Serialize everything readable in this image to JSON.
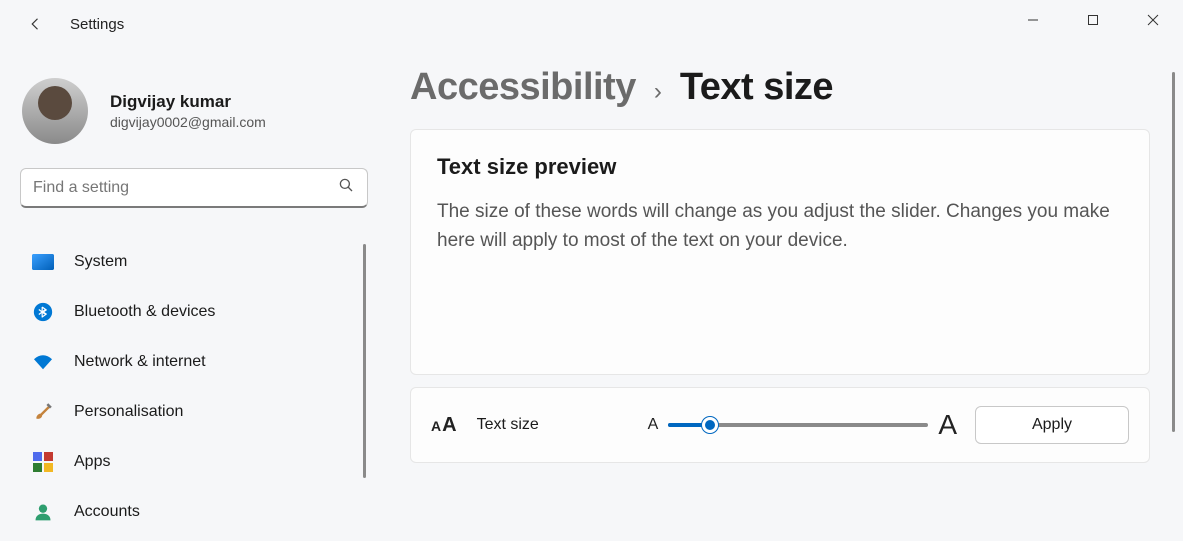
{
  "window": {
    "title": "Settings"
  },
  "user": {
    "name": "Digvijay kumar",
    "email": "digvijay0002@gmail.com"
  },
  "search": {
    "placeholder": "Find a setting"
  },
  "sidebar": {
    "items": [
      {
        "label": "System"
      },
      {
        "label": "Bluetooth & devices"
      },
      {
        "label": "Network & internet"
      },
      {
        "label": "Personalisation"
      },
      {
        "label": "Apps"
      },
      {
        "label": "Accounts"
      }
    ]
  },
  "breadcrumb": {
    "parent": "Accessibility",
    "sep": "›",
    "current": "Text size"
  },
  "preview": {
    "title": "Text size preview",
    "body": "The size of these words will change as you adjust the slider. Changes you make here will apply to most of the text on your device."
  },
  "slider": {
    "label": "Text size",
    "min_glyph": "A",
    "max_glyph": "A",
    "apply_label": "Apply"
  }
}
